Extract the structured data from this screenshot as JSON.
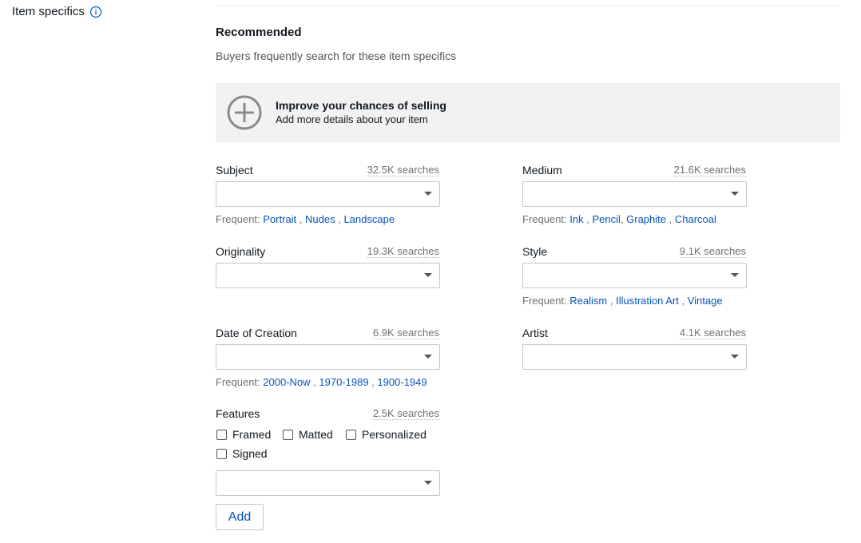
{
  "section": {
    "label": "Item specifics",
    "info_icon": "info-circle-icon"
  },
  "recommended": {
    "title": "Recommended",
    "subtitle": "Buyers frequently search for these item specifics"
  },
  "banner": {
    "icon": "plus-circle-icon",
    "title": "Improve your chances of selling",
    "subtitle": "Add more details about your item"
  },
  "frequent_label": "Frequent:",
  "fields": {
    "subject": {
      "label": "Subject",
      "count": "32.5K searches",
      "value": "",
      "frequent": [
        "Portrait",
        "Nudes",
        "Landscape"
      ]
    },
    "medium": {
      "label": "Medium",
      "count": "21.6K searches",
      "value": "",
      "frequent": [
        "Ink",
        "Pencil",
        "Graphite",
        "Charcoal"
      ]
    },
    "originality": {
      "label": "Originality",
      "count": "19.3K searches",
      "value": ""
    },
    "style": {
      "label": "Style",
      "count": "9.1K searches",
      "value": "",
      "frequent": [
        "Realism",
        "Illustration Art",
        "Vintage"
      ]
    },
    "date_of_creation": {
      "label": "Date of Creation",
      "count": "6.9K searches",
      "value": "",
      "frequent": [
        "2000-Now",
        "1970-1989",
        "1900-1949"
      ]
    },
    "artist": {
      "label": "Artist",
      "count": "4.1K searches",
      "value": ""
    },
    "features": {
      "label": "Features",
      "count": "2.5K searches",
      "value": "",
      "options": [
        "Framed",
        "Matted",
        "Personalized",
        "Signed"
      ]
    }
  },
  "add_button": "Add",
  "colors": {
    "link": "#0654ba",
    "banner_bg": "#f2f2f2",
    "border": "#c7c7c7"
  }
}
